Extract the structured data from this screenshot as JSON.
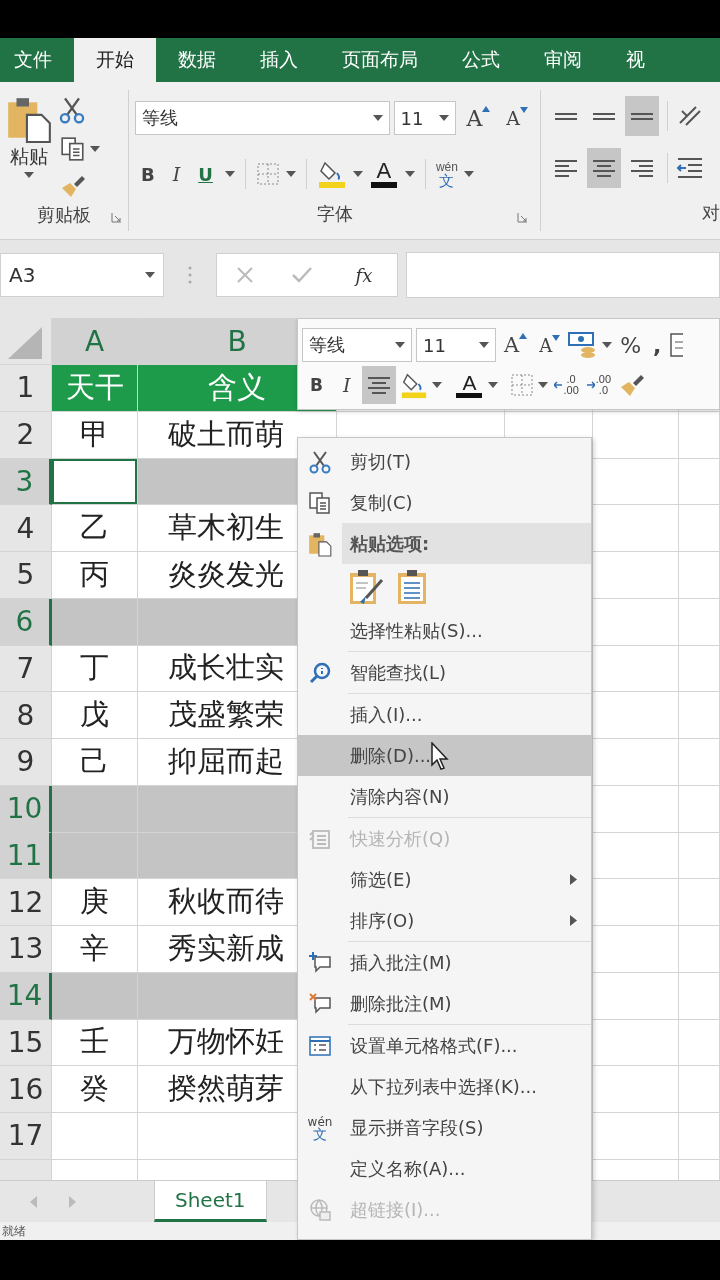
{
  "ribbon_tabs": [
    {
      "label": "文件",
      "selected": false
    },
    {
      "label": "开始",
      "selected": true
    },
    {
      "label": "数据",
      "selected": false
    },
    {
      "label": "插入",
      "selected": false
    },
    {
      "label": "页面布局",
      "selected": false
    },
    {
      "label": "公式",
      "selected": false
    },
    {
      "label": "审阅",
      "selected": false
    },
    {
      "label": "视",
      "selected": false
    }
  ],
  "ribbon": {
    "clipboard": {
      "paste": "粘贴",
      "label": "剪贴板"
    },
    "font": {
      "font_name": "等线",
      "font_size": "11",
      "grow_font": "A",
      "shrink_font": "A",
      "bold": "B",
      "italic": "I",
      "underline": "U",
      "font_color": "A",
      "phonetic": [
        "wén",
        "文"
      ],
      "label": "字体"
    },
    "alignment": {
      "label": "对"
    }
  },
  "formula_bar": {
    "name_box": "A3",
    "function_label": "fx"
  },
  "sheet": {
    "columns": [
      "A",
      "B"
    ],
    "rows": [
      {
        "number": "1",
        "kind": "header",
        "selected": false,
        "active": false,
        "cells": [
          "天干",
          "含义"
        ]
      },
      {
        "number": "2",
        "kind": "data",
        "selected": false,
        "active": false,
        "cells": [
          "甲",
          "破土而萌"
        ]
      },
      {
        "number": "3",
        "kind": "data",
        "selected": true,
        "active": true
      },
      {
        "number": "4",
        "kind": "data",
        "selected": false,
        "active": false,
        "cells": [
          "乙",
          "草木初生"
        ]
      },
      {
        "number": "5",
        "kind": "data",
        "selected": false,
        "active": false,
        "cells": [
          "丙",
          "炎炎发光"
        ]
      },
      {
        "number": "6",
        "kind": "data",
        "selected": true,
        "active": false
      },
      {
        "number": "7",
        "kind": "data",
        "selected": false,
        "active": false,
        "cells": [
          "丁",
          "成长壮实"
        ]
      },
      {
        "number": "8",
        "kind": "data",
        "selected": false,
        "active": false,
        "cells": [
          "戊",
          "茂盛繁荣"
        ]
      },
      {
        "number": "9",
        "kind": "data",
        "selected": false,
        "active": false,
        "cells": [
          "己",
          "抑屈而起"
        ]
      },
      {
        "number": "10",
        "kind": "data",
        "selected": true,
        "active": false
      },
      {
        "number": "11",
        "kind": "data",
        "selected": true,
        "active": false
      },
      {
        "number": "12",
        "kind": "data",
        "selected": false,
        "active": false,
        "cells": [
          "庚",
          "秋收而待"
        ]
      },
      {
        "number": "13",
        "kind": "data",
        "selected": false,
        "active": false,
        "cells": [
          "辛",
          "秀实新成"
        ]
      },
      {
        "number": "14",
        "kind": "data",
        "selected": true,
        "active": false
      },
      {
        "number": "15",
        "kind": "data",
        "selected": false,
        "active": false,
        "cells": [
          "壬",
          "万物怀妊"
        ]
      },
      {
        "number": "16",
        "kind": "data",
        "selected": false,
        "active": false,
        "cells": [
          "癸",
          "揆然萌芽"
        ]
      },
      {
        "number": "17",
        "kind": "data",
        "selected": false,
        "active": false
      }
    ]
  },
  "mini_toolbar": {
    "font_name": "等线",
    "font_size": "11",
    "grow_font": "A",
    "shrink_font": "A",
    "percent": "%",
    "comma": ",",
    "bold": "B",
    "italic": "I",
    "font_color": "A",
    "increase_decimal": [
      ".0",
      ".00"
    ],
    "decrease_decimal": [
      ".00",
      ".0"
    ]
  },
  "context_menu": {
    "items": [
      {
        "kind": "item",
        "label": "剪切(T)",
        "disabled": false,
        "highlighted": false,
        "submenu": false
      },
      {
        "kind": "item",
        "label": "复制(C)",
        "disabled": false,
        "highlighted": false,
        "submenu": false
      },
      {
        "kind": "header",
        "label": "粘贴选项:"
      },
      {
        "kind": "paste_options"
      },
      {
        "kind": "item",
        "label": "选择性粘贴(S)...",
        "disabled": false,
        "highlighted": false,
        "submenu": false
      },
      {
        "kind": "separator"
      },
      {
        "kind": "item",
        "label": "智能查找(L)",
        "disabled": false,
        "highlighted": false,
        "submenu": false
      },
      {
        "kind": "separator"
      },
      {
        "kind": "item",
        "label": "插入(I)...",
        "disabled": false,
        "highlighted": false,
        "submenu": false
      },
      {
        "kind": "item",
        "label": "删除(D)...",
        "disabled": false,
        "highlighted": true,
        "submenu": false
      },
      {
        "kind": "item",
        "label": "清除内容(N)",
        "disabled": false,
        "highlighted": false,
        "submenu": false
      },
      {
        "kind": "separator"
      },
      {
        "kind": "item",
        "label": "快速分析(Q)",
        "disabled": true,
        "highlighted": false,
        "submenu": false
      },
      {
        "kind": "item",
        "label": "筛选(E)",
        "disabled": false,
        "highlighted": false,
        "submenu": true
      },
      {
        "kind": "item",
        "label": "排序(O)",
        "disabled": false,
        "highlighted": false,
        "submenu": true
      },
      {
        "kind": "separator"
      },
      {
        "kind": "item",
        "label": "插入批注(M)",
        "disabled": false,
        "highlighted": false,
        "submenu": false
      },
      {
        "kind": "item",
        "label": "删除批注(M)",
        "disabled": false,
        "highlighted": false,
        "submenu": false
      },
      {
        "kind": "separator"
      },
      {
        "kind": "item",
        "label": "设置单元格格式(F)...",
        "disabled": false,
        "highlighted": false,
        "submenu": false
      },
      {
        "kind": "item",
        "label": "从下拉列表中选择(K)...",
        "disabled": false,
        "highlighted": false,
        "submenu": false
      },
      {
        "kind": "item",
        "label": "显示拼音字段(S)",
        "disabled": false,
        "highlighted": false,
        "submenu": false,
        "icon_text": [
          "wén",
          "文"
        ]
      },
      {
        "kind": "item",
        "label": "定义名称(A)...",
        "disabled": false,
        "highlighted": false,
        "submenu": false
      },
      {
        "kind": "item",
        "label": "超链接(I)...",
        "disabled": true,
        "highlighted": false,
        "submenu": false
      }
    ]
  },
  "sheet_tabs": [
    {
      "label": "Sheet1",
      "selected": true
    }
  ],
  "status_bar": {
    "text": "就绪"
  }
}
